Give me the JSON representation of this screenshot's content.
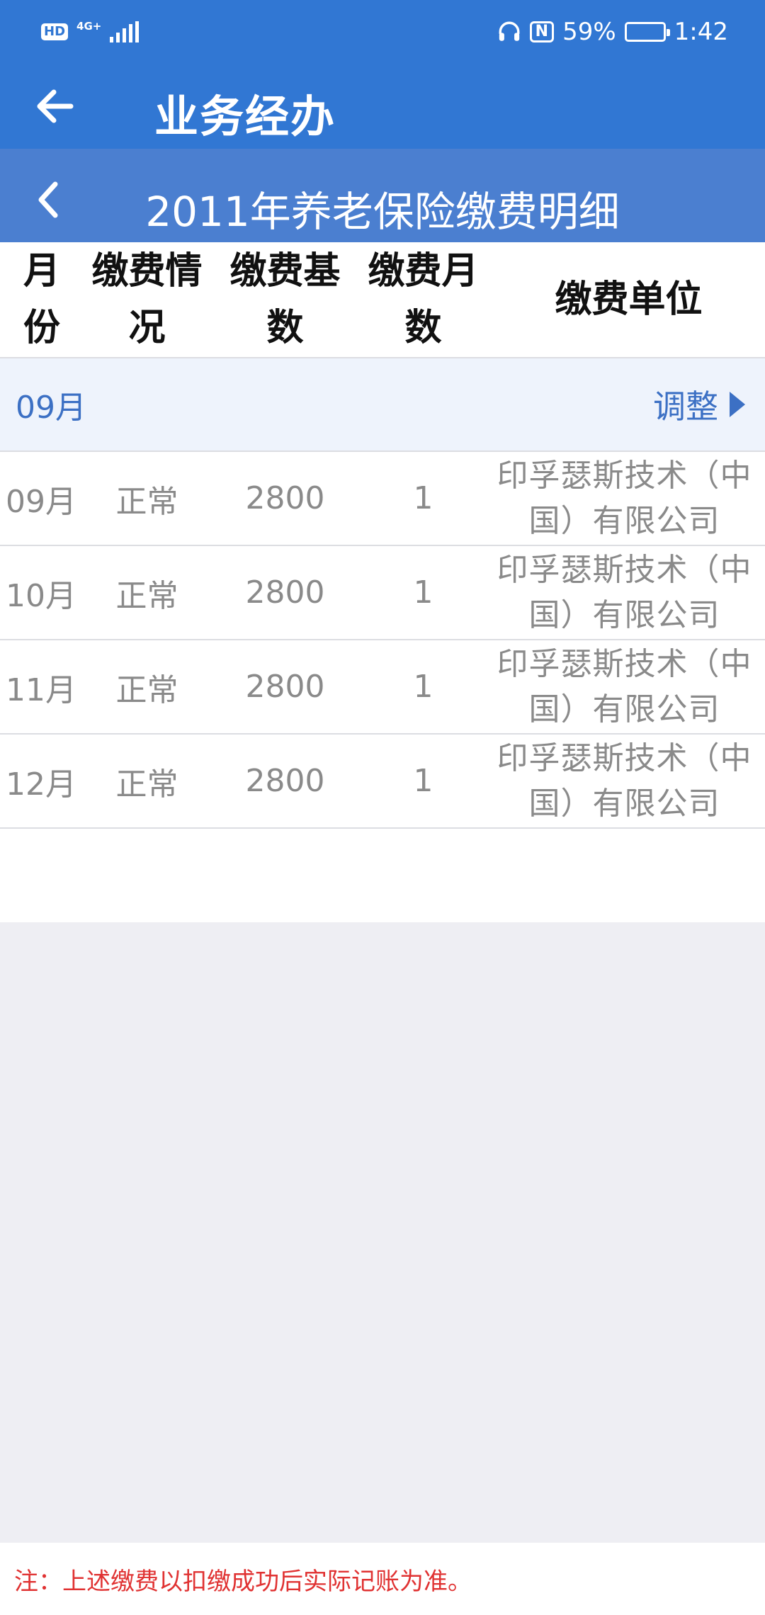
{
  "status_bar": {
    "hd": "HD",
    "network": "4G+",
    "battery_percent": "59%",
    "battery_level": 0.59,
    "time": "1:42"
  },
  "app_bar": {
    "back_icon": "arrow-left-icon",
    "title": "业务经办"
  },
  "sub_bar": {
    "back_icon": "chevron-left-icon",
    "title": "2011年养老保险缴费明细"
  },
  "table": {
    "headers": [
      "月份",
      "缴费情况",
      "缴费基数",
      "缴费月数",
      "缴费单位"
    ],
    "group": {
      "month": "09月",
      "action": "调整",
      "action_icon": "triangle-right-icon"
    },
    "rows": [
      {
        "month": "09月",
        "status": "正常",
        "base": "2800",
        "months": "1",
        "unit": "印孚瑟斯技术（中国）有限公司"
      },
      {
        "month": "10月",
        "status": "正常",
        "base": "2800",
        "months": "1",
        "unit": "印孚瑟斯技术（中国）有限公司"
      },
      {
        "month": "11月",
        "status": "正常",
        "base": "2800",
        "months": "1",
        "unit": "印孚瑟斯技术（中国）有限公司"
      },
      {
        "month": "12月",
        "status": "正常",
        "base": "2800",
        "months": "1",
        "unit": "印孚瑟斯技术（中国）有限公司"
      }
    ]
  },
  "footer": {
    "note": "注：上述缴费以扣缴成功后实际记账为准。"
  },
  "colors": {
    "primary": "#3177d3",
    "sub_bar": "#4b7fd0",
    "accent_text": "#3c70c4",
    "note_red": "#e03232"
  }
}
